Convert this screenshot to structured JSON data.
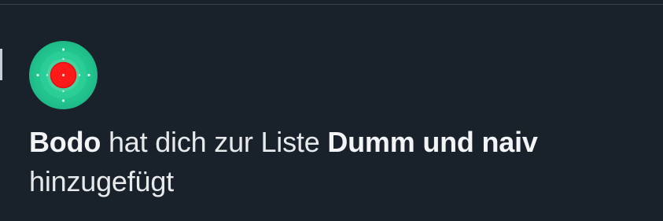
{
  "notification": {
    "actor_name": "Bodo",
    "text_before_list": " hat dich zur Liste ",
    "list_name": "Dumm und naiv",
    "text_after_list": " hinzugefügt",
    "avatar": {
      "icon": "target-avatar-icon",
      "background_color": "#22c48e",
      "center_color": "#ff1a1a"
    }
  },
  "theme": {
    "background": "#19212b",
    "text": "#e7e9ea"
  }
}
